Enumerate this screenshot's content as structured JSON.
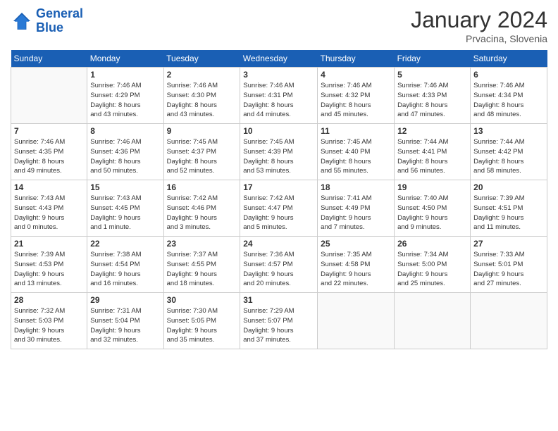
{
  "logo": {
    "line1": "General",
    "line2": "Blue"
  },
  "title": "January 2024",
  "subtitle": "Prvacina, Slovenia",
  "header_days": [
    "Sunday",
    "Monday",
    "Tuesday",
    "Wednesday",
    "Thursday",
    "Friday",
    "Saturday"
  ],
  "weeks": [
    [
      {
        "day": "",
        "sunrise": "",
        "sunset": "",
        "daylight": ""
      },
      {
        "day": "1",
        "sunrise": "Sunrise: 7:46 AM",
        "sunset": "Sunset: 4:29 PM",
        "daylight": "Daylight: 8 hours and 43 minutes."
      },
      {
        "day": "2",
        "sunrise": "Sunrise: 7:46 AM",
        "sunset": "Sunset: 4:30 PM",
        "daylight": "Daylight: 8 hours and 43 minutes."
      },
      {
        "day": "3",
        "sunrise": "Sunrise: 7:46 AM",
        "sunset": "Sunset: 4:31 PM",
        "daylight": "Daylight: 8 hours and 44 minutes."
      },
      {
        "day": "4",
        "sunrise": "Sunrise: 7:46 AM",
        "sunset": "Sunset: 4:32 PM",
        "daylight": "Daylight: 8 hours and 45 minutes."
      },
      {
        "day": "5",
        "sunrise": "Sunrise: 7:46 AM",
        "sunset": "Sunset: 4:33 PM",
        "daylight": "Daylight: 8 hours and 47 minutes."
      },
      {
        "day": "6",
        "sunrise": "Sunrise: 7:46 AM",
        "sunset": "Sunset: 4:34 PM",
        "daylight": "Daylight: 8 hours and 48 minutes."
      }
    ],
    [
      {
        "day": "7",
        "sunrise": "Sunrise: 7:46 AM",
        "sunset": "Sunset: 4:35 PM",
        "daylight": "Daylight: 8 hours and 49 minutes."
      },
      {
        "day": "8",
        "sunrise": "Sunrise: 7:46 AM",
        "sunset": "Sunset: 4:36 PM",
        "daylight": "Daylight: 8 hours and 50 minutes."
      },
      {
        "day": "9",
        "sunrise": "Sunrise: 7:45 AM",
        "sunset": "Sunset: 4:37 PM",
        "daylight": "Daylight: 8 hours and 52 minutes."
      },
      {
        "day": "10",
        "sunrise": "Sunrise: 7:45 AM",
        "sunset": "Sunset: 4:39 PM",
        "daylight": "Daylight: 8 hours and 53 minutes."
      },
      {
        "day": "11",
        "sunrise": "Sunrise: 7:45 AM",
        "sunset": "Sunset: 4:40 PM",
        "daylight": "Daylight: 8 hours and 55 minutes."
      },
      {
        "day": "12",
        "sunrise": "Sunrise: 7:44 AM",
        "sunset": "Sunset: 4:41 PM",
        "daylight": "Daylight: 8 hours and 56 minutes."
      },
      {
        "day": "13",
        "sunrise": "Sunrise: 7:44 AM",
        "sunset": "Sunset: 4:42 PM",
        "daylight": "Daylight: 8 hours and 58 minutes."
      }
    ],
    [
      {
        "day": "14",
        "sunrise": "Sunrise: 7:43 AM",
        "sunset": "Sunset: 4:43 PM",
        "daylight": "Daylight: 9 hours and 0 minutes."
      },
      {
        "day": "15",
        "sunrise": "Sunrise: 7:43 AM",
        "sunset": "Sunset: 4:45 PM",
        "daylight": "Daylight: 9 hours and 1 minute."
      },
      {
        "day": "16",
        "sunrise": "Sunrise: 7:42 AM",
        "sunset": "Sunset: 4:46 PM",
        "daylight": "Daylight: 9 hours and 3 minutes."
      },
      {
        "day": "17",
        "sunrise": "Sunrise: 7:42 AM",
        "sunset": "Sunset: 4:47 PM",
        "daylight": "Daylight: 9 hours and 5 minutes."
      },
      {
        "day": "18",
        "sunrise": "Sunrise: 7:41 AM",
        "sunset": "Sunset: 4:49 PM",
        "daylight": "Daylight: 9 hours and 7 minutes."
      },
      {
        "day": "19",
        "sunrise": "Sunrise: 7:40 AM",
        "sunset": "Sunset: 4:50 PM",
        "daylight": "Daylight: 9 hours and 9 minutes."
      },
      {
        "day": "20",
        "sunrise": "Sunrise: 7:39 AM",
        "sunset": "Sunset: 4:51 PM",
        "daylight": "Daylight: 9 hours and 11 minutes."
      }
    ],
    [
      {
        "day": "21",
        "sunrise": "Sunrise: 7:39 AM",
        "sunset": "Sunset: 4:53 PM",
        "daylight": "Daylight: 9 hours and 13 minutes."
      },
      {
        "day": "22",
        "sunrise": "Sunrise: 7:38 AM",
        "sunset": "Sunset: 4:54 PM",
        "daylight": "Daylight: 9 hours and 16 minutes."
      },
      {
        "day": "23",
        "sunrise": "Sunrise: 7:37 AM",
        "sunset": "Sunset: 4:55 PM",
        "daylight": "Daylight: 9 hours and 18 minutes."
      },
      {
        "day": "24",
        "sunrise": "Sunrise: 7:36 AM",
        "sunset": "Sunset: 4:57 PM",
        "daylight": "Daylight: 9 hours and 20 minutes."
      },
      {
        "day": "25",
        "sunrise": "Sunrise: 7:35 AM",
        "sunset": "Sunset: 4:58 PM",
        "daylight": "Daylight: 9 hours and 22 minutes."
      },
      {
        "day": "26",
        "sunrise": "Sunrise: 7:34 AM",
        "sunset": "Sunset: 5:00 PM",
        "daylight": "Daylight: 9 hours and 25 minutes."
      },
      {
        "day": "27",
        "sunrise": "Sunrise: 7:33 AM",
        "sunset": "Sunset: 5:01 PM",
        "daylight": "Daylight: 9 hours and 27 minutes."
      }
    ],
    [
      {
        "day": "28",
        "sunrise": "Sunrise: 7:32 AM",
        "sunset": "Sunset: 5:03 PM",
        "daylight": "Daylight: 9 hours and 30 minutes."
      },
      {
        "day": "29",
        "sunrise": "Sunrise: 7:31 AM",
        "sunset": "Sunset: 5:04 PM",
        "daylight": "Daylight: 9 hours and 32 minutes."
      },
      {
        "day": "30",
        "sunrise": "Sunrise: 7:30 AM",
        "sunset": "Sunset: 5:05 PM",
        "daylight": "Daylight: 9 hours and 35 minutes."
      },
      {
        "day": "31",
        "sunrise": "Sunrise: 7:29 AM",
        "sunset": "Sunset: 5:07 PM",
        "daylight": "Daylight: 9 hours and 37 minutes."
      },
      {
        "day": "",
        "sunrise": "",
        "sunset": "",
        "daylight": ""
      },
      {
        "day": "",
        "sunrise": "",
        "sunset": "",
        "daylight": ""
      },
      {
        "day": "",
        "sunrise": "",
        "sunset": "",
        "daylight": ""
      }
    ]
  ]
}
